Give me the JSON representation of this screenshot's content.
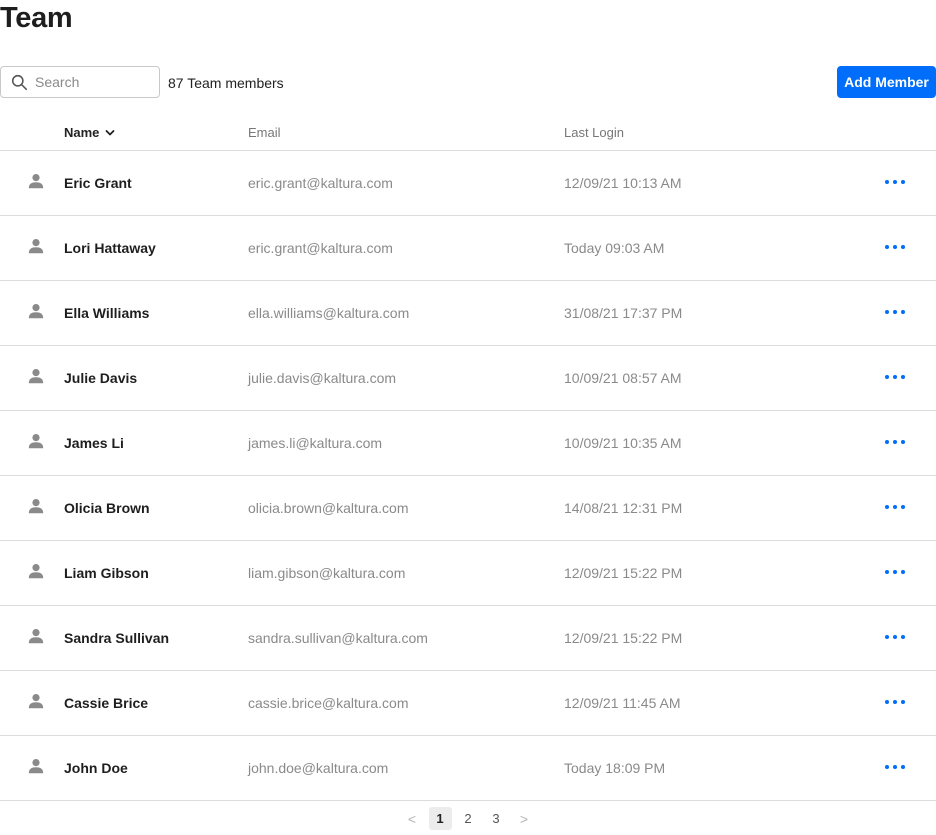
{
  "page": {
    "title": "Team"
  },
  "toolbar": {
    "search_placeholder": "Search",
    "member_count": "87 Team members",
    "add_label": "Add Member"
  },
  "table": {
    "headers": {
      "name": "Name",
      "email": "Email",
      "last_login": "Last Login"
    },
    "sort": {
      "column": "name",
      "direction": "descending"
    },
    "rows": [
      {
        "name": "Eric Grant",
        "email": "eric.grant@kaltura.com",
        "last_login": "12/09/21 10:13 AM"
      },
      {
        "name": "Lori Hattaway",
        "email": "eric.grant@kaltura.com",
        "last_login": "Today 09:03 AM"
      },
      {
        "name": "Ella Williams",
        "email": "ella.williams@kaltura.com",
        "last_login": "31/08/21 17:37 PM"
      },
      {
        "name": "Julie Davis",
        "email": "julie.davis@kaltura.com",
        "last_login": "10/09/21 08:57 AM"
      },
      {
        "name": "James Li",
        "email": "james.li@kaltura.com",
        "last_login": "10/09/21 10:35 AM"
      },
      {
        "name": "Olicia Brown",
        "email": "olicia.brown@kaltura.com",
        "last_login": "14/08/21 12:31 PM"
      },
      {
        "name": "Liam Gibson",
        "email": "liam.gibson@kaltura.com",
        "last_login": "12/09/21 15:22 PM"
      },
      {
        "name": "Sandra Sullivan",
        "email": "sandra.sullivan@kaltura.com",
        "last_login": "12/09/21 15:22 PM"
      },
      {
        "name": "Cassie Brice",
        "email": "cassie.brice@kaltura.com",
        "last_login": "12/09/21 11:45 AM"
      },
      {
        "name": "John Doe",
        "email": "john.doe@kaltura.com",
        "last_login": "Today 18:09 PM"
      }
    ]
  },
  "pagination": {
    "prev": "<",
    "next": ">",
    "pages": [
      "1",
      "2",
      "3"
    ],
    "current": "1"
  },
  "colors": {
    "accent": "#006efa",
    "divider": "#dcdcdc",
    "muted_text": "#8a8a8a",
    "avatar": "#8a8a8a"
  },
  "icons": {
    "search": "search-icon",
    "sort": "chevron-down-icon",
    "avatar": "user-avatar-icon",
    "row_menu": "more-horizontal-icon"
  }
}
